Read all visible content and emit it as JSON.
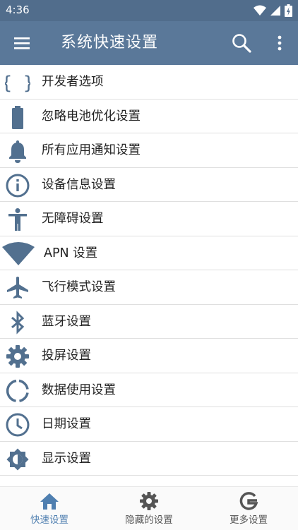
{
  "status_bar": {
    "time": "4:36"
  },
  "app_bar": {
    "title": "系统快速设置"
  },
  "items": [
    {
      "label": "开发者选项",
      "icon": "code-braces-icon"
    },
    {
      "label": "忽略电池优化设置",
      "icon": "battery-icon"
    },
    {
      "label": "所有应用通知设置",
      "icon": "bell-icon"
    },
    {
      "label": "设备信息设置",
      "icon": "info-icon"
    },
    {
      "label": "无障碍设置",
      "icon": "accessibility-icon"
    },
    {
      "label": "APN 设置",
      "icon": "signal-wedge-icon"
    },
    {
      "label": "飞行模式设置",
      "icon": "airplane-icon"
    },
    {
      "label": "蓝牙设置",
      "icon": "bluetooth-icon"
    },
    {
      "label": "投屏设置",
      "icon": "gear-icon"
    },
    {
      "label": "数据使用设置",
      "icon": "data-usage-icon"
    },
    {
      "label": "日期设置",
      "icon": "clock-icon"
    },
    {
      "label": "显示设置",
      "icon": "brightness-icon"
    }
  ],
  "bottom_nav": [
    {
      "label": "快速设置",
      "icon": "home-icon",
      "active": true
    },
    {
      "label": "隐藏的设置",
      "icon": "gear-icon",
      "active": false
    },
    {
      "label": "更多设置",
      "icon": "google-g-icon",
      "active": false
    }
  ],
  "colors": {
    "status_bar": "#516d8c",
    "app_bar": "#5a7899",
    "icon": "#52708f",
    "active_nav": "#4f7fb0",
    "inactive_nav": "#555555"
  }
}
